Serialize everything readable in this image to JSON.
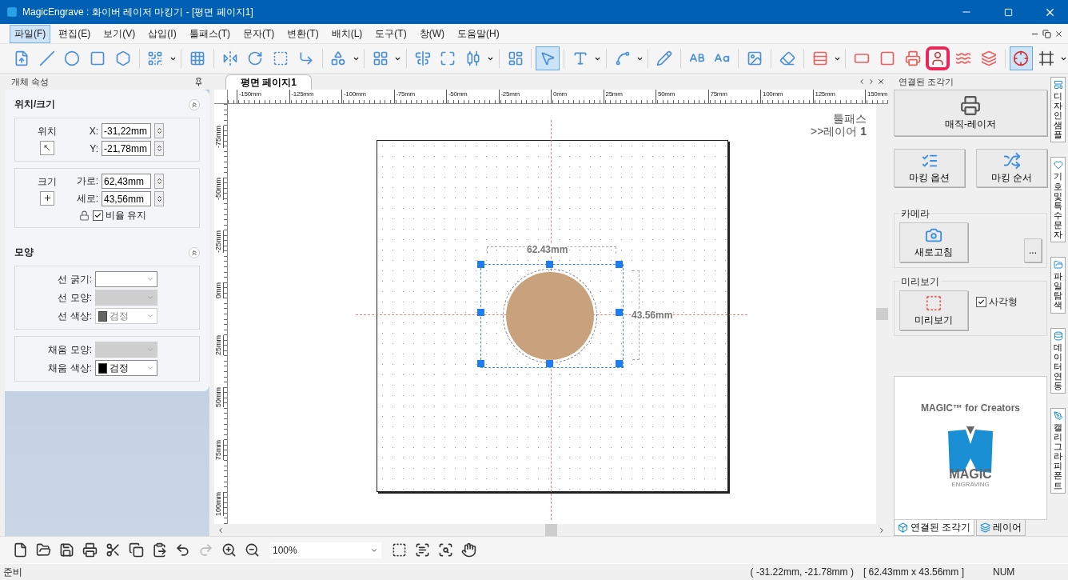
{
  "window": {
    "title": "MagicEngrave : 화이버 레이저 마킹기 - [평면  페이지1]"
  },
  "menu": [
    {
      "label": "파일(F)",
      "selected": true
    },
    {
      "label": "편집(E)",
      "selected": false
    },
    {
      "label": "보기(V)",
      "selected": false
    },
    {
      "label": "삽입(I)",
      "selected": false
    },
    {
      "label": "툴패스(T)",
      "selected": false
    },
    {
      "label": "문자(T)",
      "selected": false
    },
    {
      "label": "변환(T)",
      "selected": false
    },
    {
      "label": "배치(L)",
      "selected": false
    },
    {
      "label": "도구(T)",
      "selected": false
    },
    {
      "label": "창(W)",
      "selected": false
    },
    {
      "label": "도움말(H)",
      "selected": false
    }
  ],
  "toolbar": {
    "groups": [
      [
        {
          "kind": "svg",
          "selected": false,
          "dropdown": false,
          "highlighted": false
        },
        {
          "kind": "line",
          "selected": false,
          "dropdown": false,
          "highlighted": false
        },
        {
          "kind": "circle",
          "selected": false,
          "dropdown": false,
          "highlighted": false
        },
        {
          "kind": "rect",
          "selected": false,
          "dropdown": false,
          "highlighted": false
        },
        {
          "kind": "hexagon",
          "selected": false,
          "dropdown": false,
          "highlighted": false
        }
      ],
      [
        {
          "kind": "qr",
          "selected": false,
          "dropdown": true,
          "highlighted": false
        }
      ],
      [
        {
          "kind": "table",
          "selected": false,
          "dropdown": false,
          "highlighted": false
        }
      ],
      [
        {
          "kind": "mirror",
          "selected": false,
          "dropdown": false,
          "highlighted": false
        },
        {
          "kind": "rotate",
          "selected": false,
          "dropdown": false,
          "highlighted": false
        },
        {
          "kind": "textbox",
          "selected": false,
          "dropdown": false,
          "highlighted": false
        },
        {
          "kind": "angle",
          "selected": false,
          "dropdown": false,
          "highlighted": false
        }
      ],
      [
        {
          "kind": "shape",
          "selected": false,
          "dropdown": true,
          "highlighted": false
        }
      ],
      [
        {
          "kind": "grid",
          "selected": false,
          "dropdown": true,
          "highlighted": false
        }
      ],
      [
        {
          "kind": "center",
          "selected": false,
          "dropdown": false,
          "highlighted": false
        },
        {
          "kind": "size",
          "selected": false,
          "dropdown": false,
          "highlighted": false
        },
        {
          "kind": "align",
          "selected": false,
          "dropdown": true,
          "highlighted": false
        }
      ],
      [
        {
          "kind": "cards",
          "selected": false,
          "dropdown": false,
          "highlighted": false
        }
      ],
      [
        {
          "kind": "select",
          "selected": true,
          "dropdown": false,
          "highlighted": false
        }
      ],
      [
        {
          "kind": "text",
          "selected": false,
          "dropdown": true,
          "highlighted": false
        }
      ],
      [
        {
          "kind": "arc",
          "selected": false,
          "dropdown": true,
          "highlighted": false
        }
      ],
      [
        {
          "kind": "pencil",
          "selected": false,
          "dropdown": false,
          "highlighted": false
        }
      ],
      [
        {
          "kind": "upper",
          "selected": false,
          "dropdown": false,
          "highlighted": false
        },
        {
          "kind": "cases",
          "selected": false,
          "dropdown": false,
          "highlighted": false
        }
      ],
      [
        {
          "kind": "image",
          "selected": false,
          "dropdown": false,
          "highlighted": false
        }
      ],
      [
        {
          "kind": "eraser",
          "selected": false,
          "dropdown": false,
          "highlighted": false
        }
      ],
      [
        {
          "kind": "hatch",
          "selected": false,
          "dropdown": true,
          "highlighted": false
        }
      ],
      [
        {
          "kind": "frame",
          "selected": false,
          "dropdown": false,
          "highlighted": false
        },
        {
          "kind": "square",
          "selected": false,
          "dropdown": false,
          "highlighted": false
        },
        {
          "kind": "laser",
          "selected": false,
          "dropdown": false,
          "highlighted": false
        },
        {
          "kind": "portrait",
          "selected": false,
          "dropdown": false,
          "highlighted": true
        },
        {
          "kind": "wave",
          "selected": false,
          "dropdown": false,
          "highlighted": false
        },
        {
          "kind": "layers",
          "selected": false,
          "dropdown": false,
          "highlighted": false
        }
      ],
      [
        {
          "kind": "crosshair",
          "selected": true,
          "dropdown": false,
          "highlighted": false
        },
        {
          "kind": "border",
          "selected": false,
          "dropdown": true,
          "highlighted": false
        }
      ]
    ]
  },
  "properties": {
    "title": "개체 속성",
    "position_size": {
      "title": "위치/크기",
      "expanded": true,
      "position_label": "위치",
      "x_label": "X:",
      "x": "-31,22mm",
      "y_label": "Y:",
      "y": "-21,78mm",
      "size_label": "크기",
      "width_label": "가로:",
      "width": "62,43mm",
      "height_label": "세로:",
      "height": "43,56mm",
      "keep_ratio": {
        "label": "비율 유지",
        "checked": true
      }
    },
    "shape": {
      "title": "모양",
      "expanded": true,
      "groups": [
        [
          {
            "label": "선 굵기:",
            "disabled": false
          },
          {
            "label": "선 모양:",
            "disabled": true
          },
          {
            "label": "선 색상:",
            "value": "검정",
            "disabled": true
          }
        ],
        [
          {
            "label": "채움 모양:",
            "disabled": true
          },
          {
            "label": "채움 색상:",
            "value": "검정",
            "disabled": false
          }
        ]
      ]
    }
  },
  "document": {
    "tabs": [
      {
        "label": "평면  페이지1",
        "selected": true
      }
    ],
    "ruler": {
      "top": [
        "-150mm",
        "-125mm",
        "-100mm",
        "-75mm",
        "-50mm",
        "-25mm",
        "0mm",
        "25mm",
        "50mm",
        "75mm",
        "100mm",
        "125mm",
        "150mm"
      ],
      "left": [
        "-75mm",
        "-50mm",
        "-25mm",
        "0mm",
        "25mm",
        "50mm",
        "75mm",
        "100mm"
      ]
    },
    "page_label": {
      "line1": "툴패스",
      "line2": ">>레이어 **1**"
    },
    "selection": {
      "width_label": "62.43mm",
      "height_label": "43.56mm"
    }
  },
  "engraver": {
    "title": "연결된 조각기",
    "machine": "매직-레이저",
    "buttons": [
      {
        "kind": "options",
        "label": "마킹 옵션"
      },
      {
        "kind": "order",
        "label": "마킹 순서"
      }
    ],
    "camera": {
      "title": "카메라",
      "refresh": "새로고침",
      "more": "..."
    },
    "preview": {
      "title": "미리보기",
      "button": "미리보기",
      "rectangle": {
        "label": "사각형",
        "checked": true
      }
    },
    "ad": {
      "title": "MAGIC™ for Creators",
      "logo_word": "MAGIC",
      "logo_sub": "ENGRAVING"
    },
    "tabs": [
      {
        "label": "연결된 조각기",
        "selected": true,
        "kind": "engraver"
      },
      {
        "label": "레이어",
        "selected": false,
        "kind": "layers"
      }
    ]
  },
  "side_tabs": [
    {
      "label": "디자인 샘플",
      "kind": "samples"
    },
    {
      "label": "기호 및 특수문자",
      "kind": "symbols"
    },
    {
      "label": "파일 탐색",
      "kind": "files"
    },
    {
      "label": "데이터 연동",
      "kind": "data"
    },
    {
      "label": "캘리그라피 폰트",
      "kind": "fonts"
    }
  ],
  "bottom_toolbar": [
    {
      "kind": "new",
      "disabled": false
    },
    {
      "kind": "open",
      "disabled": false
    },
    {
      "kind": "save",
      "disabled": false
    },
    {
      "kind": "print",
      "disabled": false
    },
    {
      "kind": "cut",
      "disabled": false
    },
    {
      "kind": "copy",
      "disabled": false
    },
    {
      "kind": "paste",
      "disabled": false
    },
    {
      "kind": "undo",
      "disabled": false
    },
    {
      "kind": "redo",
      "disabled": true
    },
    {
      "kind": "zoomin",
      "disabled": false
    },
    {
      "kind": "zoomout",
      "disabled": false
    },
    {
      "kind": "zoom",
      "value": "100%",
      "disabled": false
    },
    {
      "kind": "zoomarea",
      "disabled": false
    },
    {
      "kind": "zoomtext",
      "disabled": false
    },
    {
      "kind": "zoomfit",
      "disabled": false
    },
    {
      "kind": "hand",
      "disabled": false
    }
  ],
  "status_bar": {
    "message": "준비",
    "position": "( -31.22mm, -21.78mm )",
    "size": "[ 62.43mm x 43.56mm ]",
    "num": "NUM"
  }
}
